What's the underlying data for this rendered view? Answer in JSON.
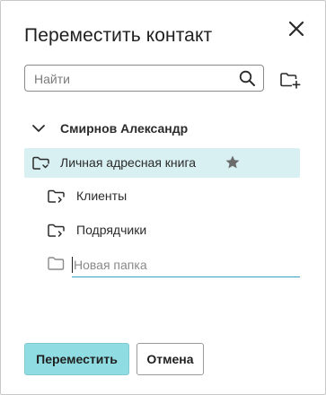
{
  "dialog": {
    "title": "Переместить контакт",
    "close_icon": "close-icon"
  },
  "search": {
    "placeholder": "Найти",
    "value": "",
    "icon": "search-icon"
  },
  "new_folder_button": {
    "icon": "folder-add-icon"
  },
  "tree": {
    "owner": {
      "label": "Смирнов Александр",
      "expanded": true,
      "icon": "chevron-down-icon"
    },
    "address_book": {
      "label": "Личная адресная книга",
      "selected": true,
      "favorite": true,
      "icon": "shared-folder-icon"
    },
    "folders": [
      {
        "label": "Клиенты",
        "icon": "shared-folder-icon"
      },
      {
        "label": "Подрядчики",
        "icon": "shared-folder-icon"
      }
    ],
    "new_folder": {
      "placeholder": "Новая папка",
      "value": "",
      "icon": "folder-icon"
    }
  },
  "buttons": {
    "move_label": "Переместить",
    "cancel_label": "Отмена"
  },
  "colors": {
    "selected_row": "#d8f0f2",
    "primary_button": "#8fdde2",
    "input_underline": "#3aa0c8",
    "star": "#6b6b6b"
  }
}
